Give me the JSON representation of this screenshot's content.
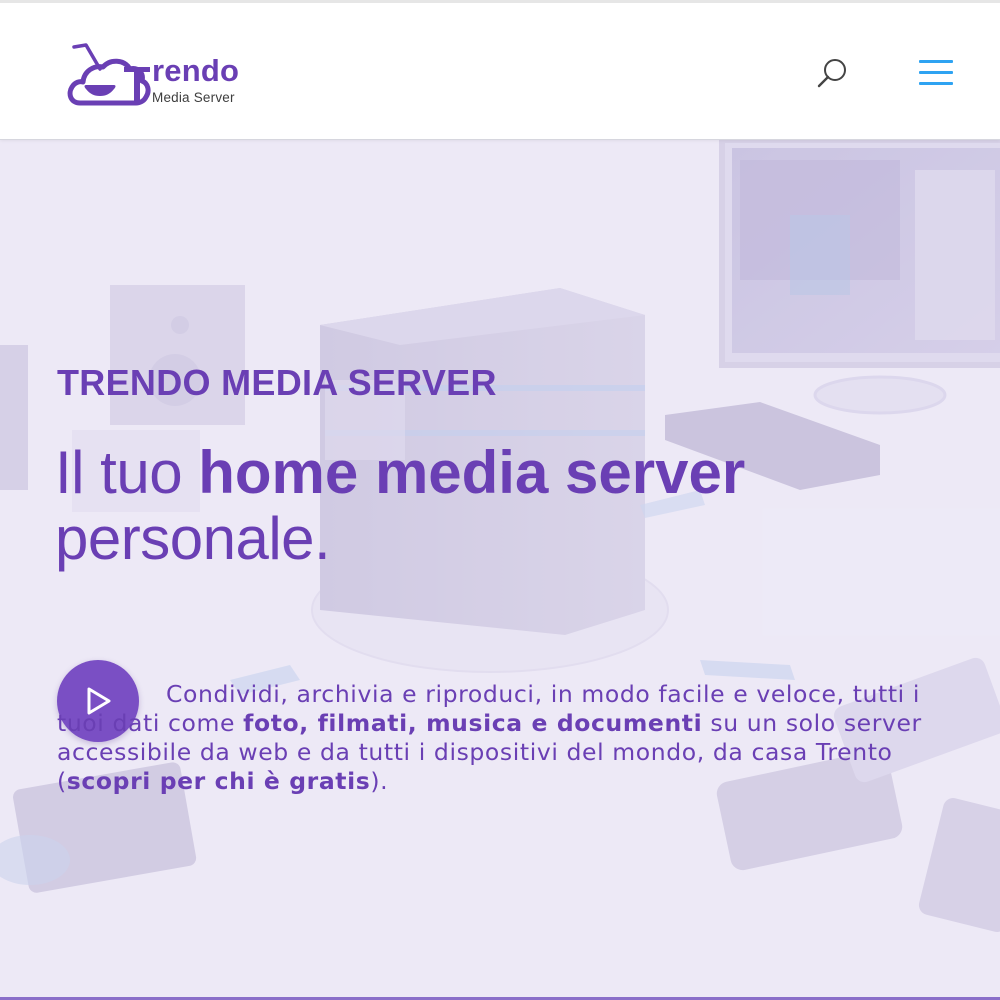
{
  "brand": {
    "name": "rendo",
    "initial": "T",
    "subtitle": "Media Server",
    "color": "#6a3fb4"
  },
  "header": {
    "search_icon": "search-icon",
    "menu_icon": "hamburger-menu-icon",
    "menu_color": "#2ea3f2"
  },
  "hero": {
    "eyebrow": "TRENDO MEDIA SERVER",
    "headline_light_1": "Il tuo ",
    "headline_bold": "home media server",
    "headline_light_2": "personale.",
    "play_icon": "play-icon",
    "description": {
      "part1": "Condividi, archivia e riproduci, in modo facile e veloce, tutti i tuoi dati come ",
      "bold1": "foto, filmati, musica e documenti",
      "part2": " su un solo server accessibile da web e da tutti i dispositivi del mondo, da casa Trento (",
      "link": "scopri per chi è gratis",
      "part3": ")."
    },
    "background_image": "home-media-devices-photo"
  },
  "colors": {
    "accent": "#6a3fb4",
    "play_button": "#7a4fc4",
    "hero_tint": "#ecebf4"
  }
}
